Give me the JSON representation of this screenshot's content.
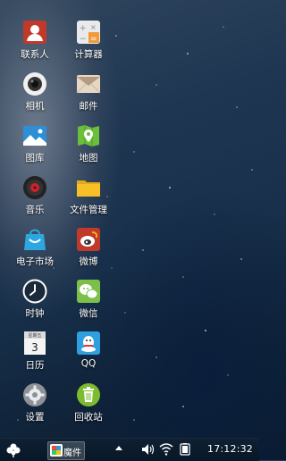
{
  "apps": [
    {
      "label": "联系人",
      "icon": "contacts-icon"
    },
    {
      "label": "计算器",
      "icon": "calculator-icon"
    },
    {
      "label": "相机",
      "icon": "camera-icon"
    },
    {
      "label": "邮件",
      "icon": "mail-icon"
    },
    {
      "label": "图库",
      "icon": "gallery-icon"
    },
    {
      "label": "地图",
      "icon": "map-icon"
    },
    {
      "label": "音乐",
      "icon": "music-icon"
    },
    {
      "label": "文件管理",
      "icon": "folder-icon"
    },
    {
      "label": "电子市场",
      "icon": "market-bag-icon"
    },
    {
      "label": "微博",
      "icon": "weibo-icon"
    },
    {
      "label": "时钟",
      "icon": "clock-icon"
    },
    {
      "label": "微信",
      "icon": "wechat-icon"
    },
    {
      "label": "日历",
      "icon": "calendar-icon",
      "calendar_header": "星期五",
      "calendar_day": "3"
    },
    {
      "label": "QQ",
      "icon": "qq-icon"
    },
    {
      "label": "设置",
      "icon": "settings-gear-icon"
    },
    {
      "label": "回收站",
      "icon": "recycle-bin-icon"
    }
  ],
  "taskbar": {
    "start_icon": "clover-start-icon",
    "task_label": "魔件",
    "task_icon": "mojian-app-icon",
    "tray_icons": [
      "tray-up-arrow-icon",
      "volume-icon",
      "wifi-icon",
      "battery-icon"
    ],
    "clock": "17:12:32"
  },
  "colors": {
    "contacts": "#c0392b",
    "calculator": "#e8eaec",
    "mail": "#e6d7c3",
    "gallery": "#2e8fd6",
    "map": "#6abf3b",
    "folder": "#f6c026",
    "market": "#2ea7e0",
    "weibo": "#c0392b",
    "wechat": "#7cc04a",
    "qq": "#2f9fe0",
    "settings": "#8c9297",
    "recycle": "#7dbb2f"
  }
}
